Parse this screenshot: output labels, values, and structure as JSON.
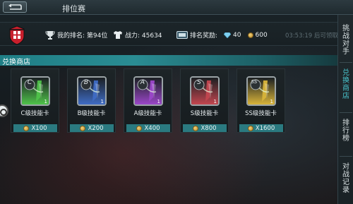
{
  "header": {
    "title": "排位赛"
  },
  "info": {
    "rank_text": "我的排名: 第94位",
    "power_text": "战力: 45634",
    "reward_label": "排名奖励:",
    "gem_value": "40",
    "coin_value": "600",
    "countdown_text": "03:53:19 后可领取"
  },
  "shop": {
    "section_title": "兑换商店",
    "cards": [
      {
        "grade": "C",
        "label": "C级技能卡",
        "price": "X100",
        "count": "1",
        "color": "#4fc24a"
      },
      {
        "grade": "B",
        "label": "B级技能卡",
        "price": "X200",
        "count": "1",
        "color": "#3f6cc4"
      },
      {
        "grade": "A",
        "label": "A级技能卡",
        "price": "X400",
        "count": "1",
        "color": "#9b47c9"
      },
      {
        "grade": "S",
        "label": "S级技能卡",
        "price": "X800",
        "count": "1",
        "color": "#c2464f"
      },
      {
        "grade": "SS",
        "label": "SS级技能卡",
        "price": "X1600",
        "count": "1",
        "color": "#d8b43a"
      }
    ]
  },
  "sidebar": {
    "tabs": [
      {
        "label": "挑战对手",
        "chars": [
          "挑",
          "战",
          "对",
          "手"
        ]
      },
      {
        "label": "兑换商店",
        "chars": [
          "兑",
          "换",
          "商",
          "店"
        ]
      },
      {
        "label": "排行榜",
        "chars": [
          "排",
          "行",
          "榜"
        ]
      },
      {
        "label": "对战记录",
        "chars": [
          "对",
          "战",
          "记",
          "录"
        ]
      }
    ],
    "active_index": 1
  },
  "colors": {
    "accent": "#2a8c93",
    "price_bar": "#2a7a80",
    "active_tab": "#49c6cf"
  }
}
